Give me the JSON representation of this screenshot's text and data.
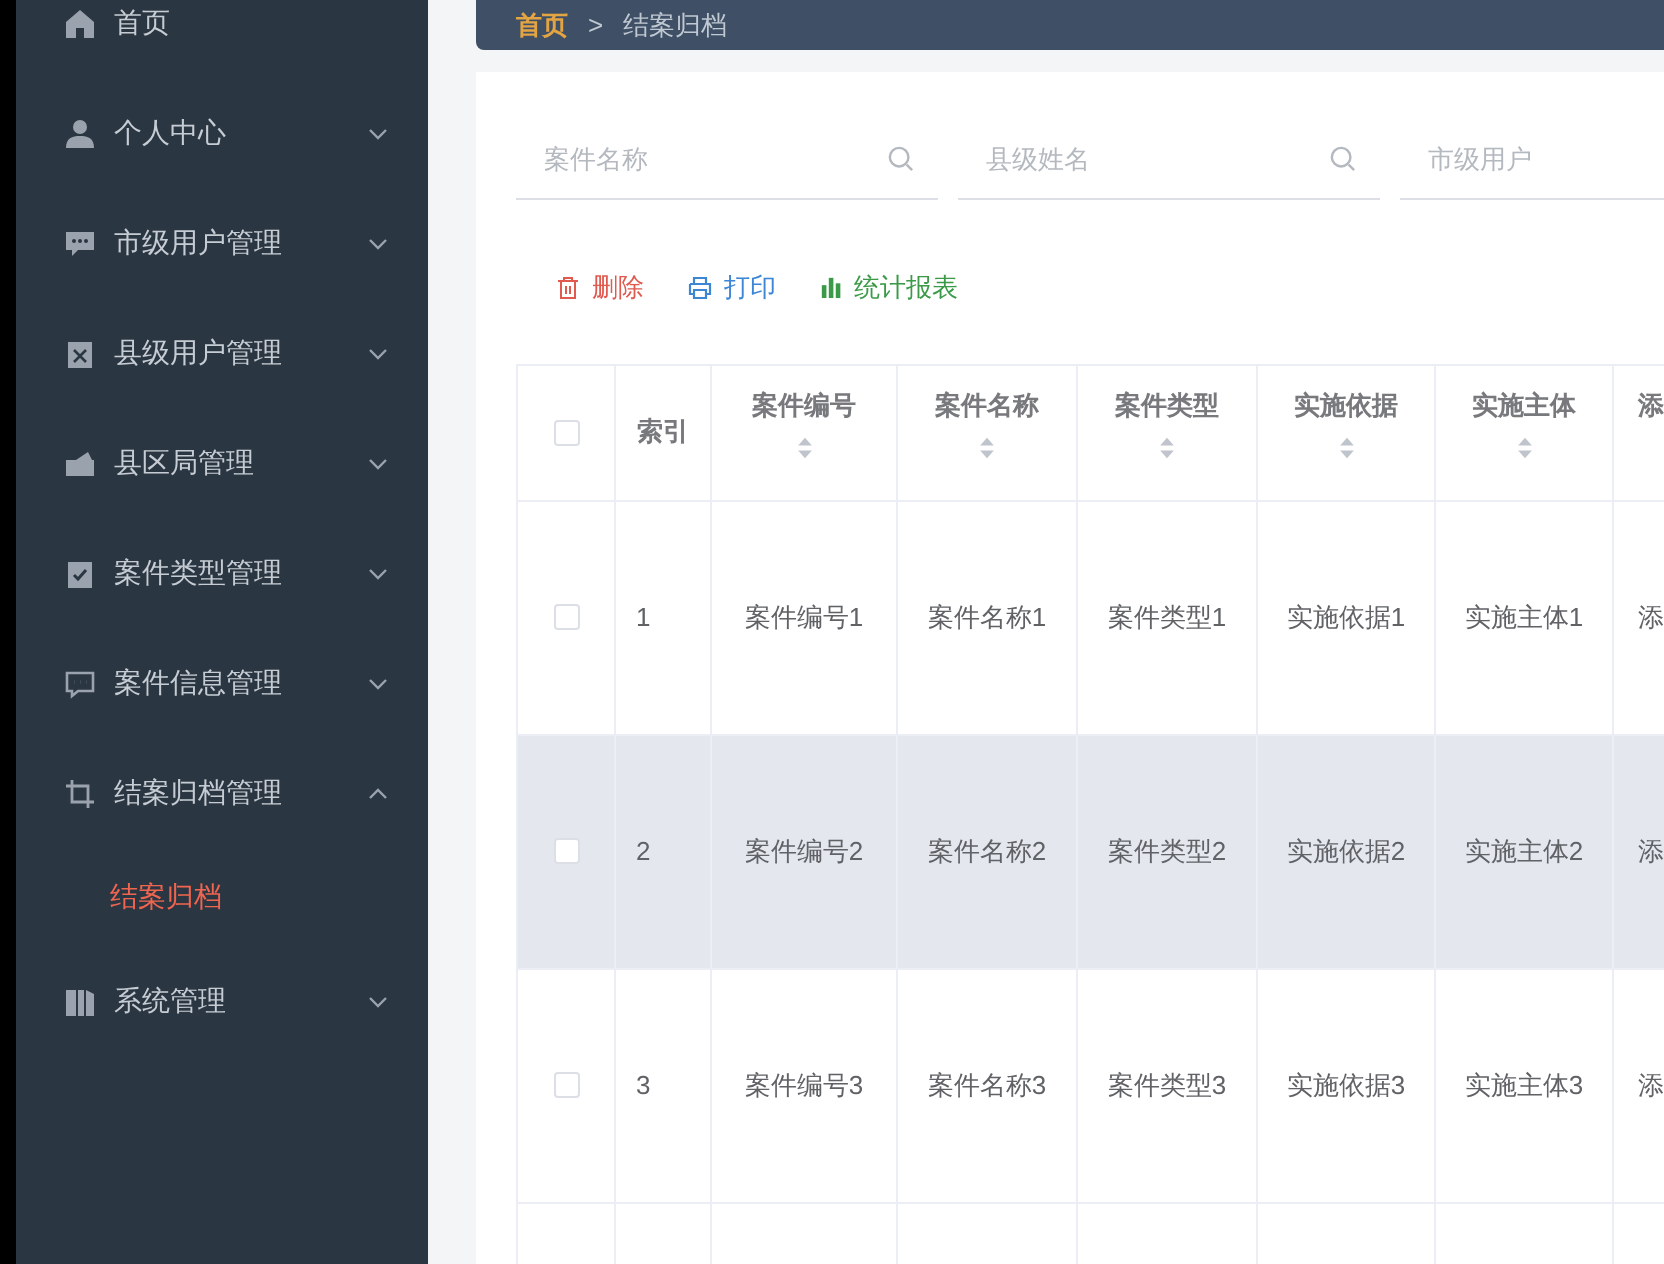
{
  "sidebar": {
    "items": [
      {
        "label": "首页",
        "kind": "link"
      },
      {
        "label": "个人中心",
        "kind": "submenu",
        "expanded": false
      },
      {
        "label": "市级用户管理",
        "kind": "submenu",
        "expanded": false
      },
      {
        "label": "县级用户管理",
        "kind": "submenu",
        "expanded": false
      },
      {
        "label": "县区局管理",
        "kind": "submenu",
        "expanded": false
      },
      {
        "label": "案件类型管理",
        "kind": "submenu",
        "expanded": false
      },
      {
        "label": "案件信息管理",
        "kind": "submenu",
        "expanded": false
      },
      {
        "label": "结案归档管理",
        "kind": "submenu",
        "expanded": true,
        "children": [
          {
            "label": "结案归档",
            "selected": true
          }
        ]
      },
      {
        "label": "系统管理",
        "kind": "submenu",
        "expanded": false
      }
    ]
  },
  "breadcrumb": [
    {
      "label": "首页",
      "kind": "link"
    },
    {
      "label": ">",
      "kind": "separator"
    },
    {
      "label": "结案归档",
      "kind": "current"
    }
  ],
  "search_fields": [
    {
      "placeholder": "案件名称",
      "search_icon": true
    },
    {
      "placeholder": "县级姓名",
      "search_icon": true
    },
    {
      "placeholder": "市级用户"
    }
  ],
  "actions": [
    {
      "label": "删除",
      "kind": "delete"
    },
    {
      "label": "打印",
      "kind": "print"
    },
    {
      "label": "统计报表",
      "kind": "report"
    }
  ],
  "table": {
    "select_all_checked": false,
    "columns": [
      {
        "label": "索引",
        "sortable": false
      },
      {
        "label": "案件编号",
        "sortable": true
      },
      {
        "label": "案件名称",
        "sortable": true
      },
      {
        "label": "案件类型",
        "sortable": true
      },
      {
        "label": "实施依据",
        "sortable": true
      },
      {
        "label": "实施主体",
        "sortable": true
      },
      {
        "label": "添",
        "sortable": false
      }
    ],
    "rows": [
      {
        "checked": false,
        "highlighted": false,
        "cells": [
          "1",
          "案件编号1",
          "案件名称1",
          "案件类型1",
          "实施依据1",
          "实施主体1",
          "添"
        ]
      },
      {
        "checked": false,
        "highlighted": true,
        "cells": [
          "2",
          "案件编号2",
          "案件名称2",
          "案件类型2",
          "实施依据2",
          "实施主体2",
          "添"
        ]
      },
      {
        "checked": false,
        "highlighted": false,
        "cells": [
          "3",
          "案件编号3",
          "案件名称3",
          "案件类型3",
          "实施依据3",
          "实施主体3",
          "添"
        ]
      }
    ]
  }
}
